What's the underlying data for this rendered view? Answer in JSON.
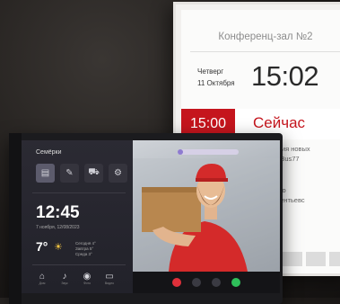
{
  "room_panel": {
    "title": "Конференц-зал №2",
    "day": "Четверг",
    "date": "11 Октября",
    "time": "15:02",
    "now_time": "15:00",
    "now_label": "Сейчас",
    "event_lines": [
      "зация новых",
      "ия Bus77",
      "анио",
      "Олентьевс"
    ]
  },
  "intercom": {
    "location": "Семёрки",
    "clock": "12:45",
    "date_text": "7 ноября, 12/08/2023",
    "temperature": "7°",
    "forecast_lines": [
      "Сегодня 4°",
      "Завтра 5°",
      "Среда 3°"
    ],
    "dock": [
      {
        "icon": "home-icon",
        "label": "Дом"
      },
      {
        "icon": "microphone-icon",
        "label": "Звук"
      },
      {
        "icon": "camera-icon",
        "label": "Фото"
      },
      {
        "icon": "video-camera-icon",
        "label": "Видео"
      }
    ],
    "tiles": [
      "document-icon",
      "edit-icon",
      "car-icon",
      "settings-icon"
    ]
  },
  "colors": {
    "accent_red": "#c5151d",
    "tablet_bg": "#26262c",
    "end_call": "#e0303a",
    "accept_call": "#2fbf5a"
  }
}
